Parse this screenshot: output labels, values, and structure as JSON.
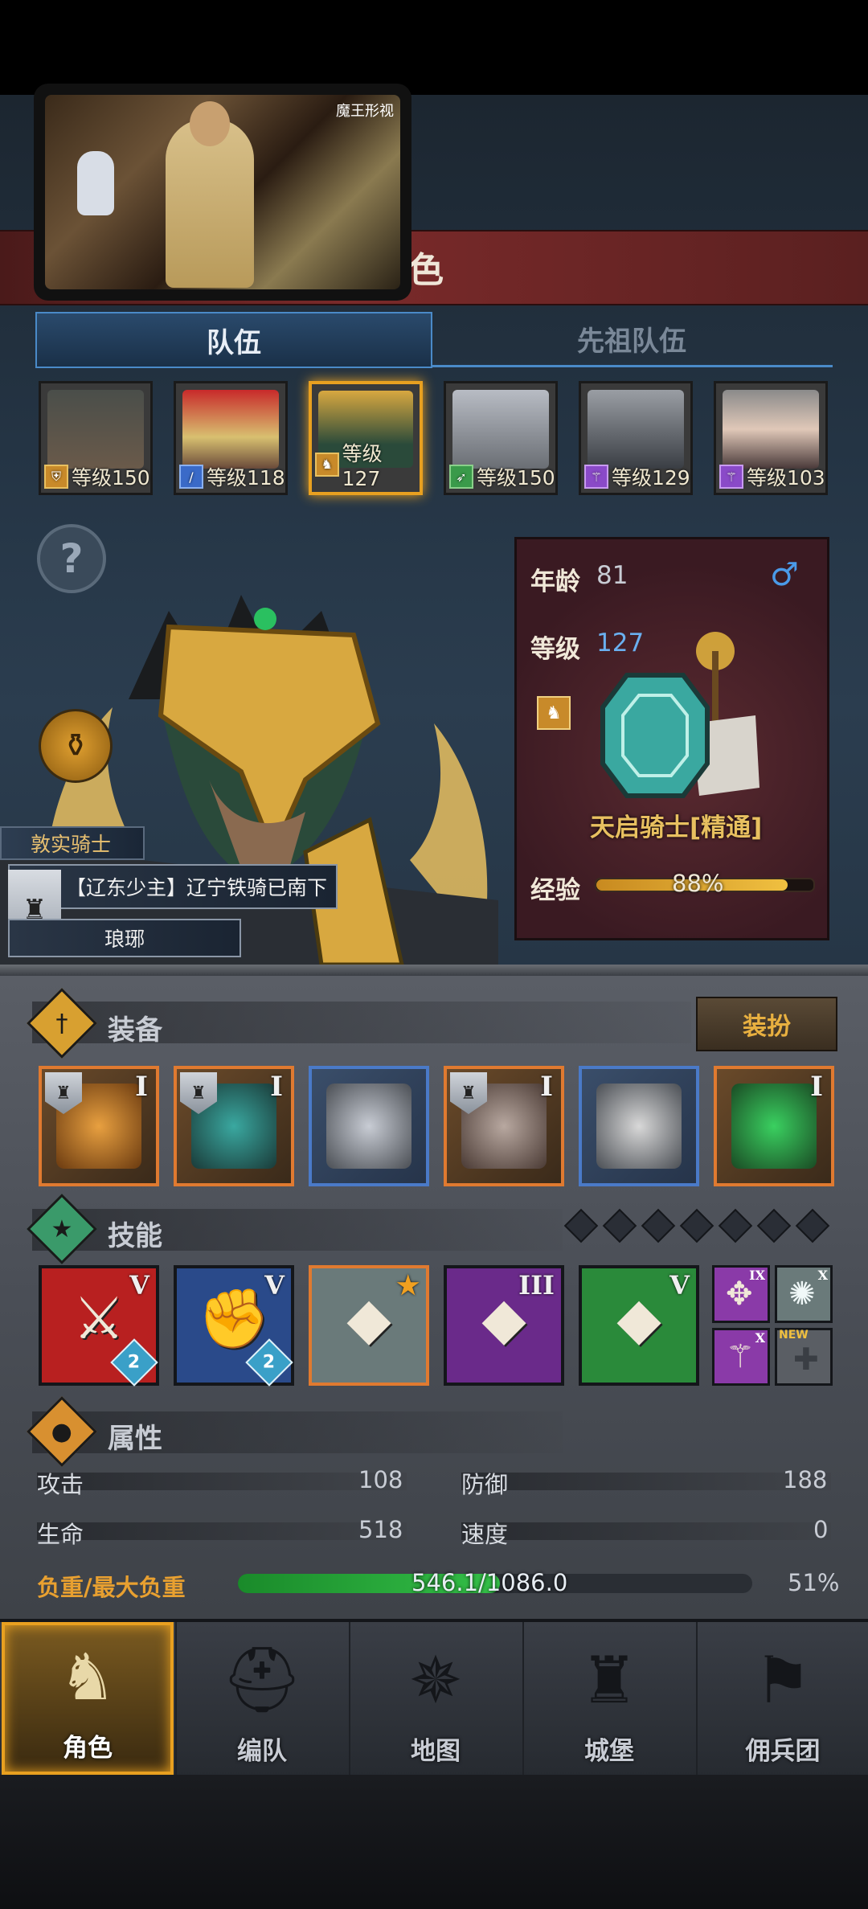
{
  "header": {
    "title": "角色"
  },
  "video": {
    "logo": "魔王形视"
  },
  "tabs": [
    {
      "label": "队伍",
      "active": true
    },
    {
      "label": "先祖队伍",
      "active": false
    }
  ],
  "team": [
    {
      "level": "等级150",
      "class_icon": "shield-class-icon",
      "color": "#d89030"
    },
    {
      "level": "等级118",
      "class_icon": "sword-class-icon",
      "color": "#3a6ac8"
    },
    {
      "level": "等级127",
      "class_icon": "horse-class-icon",
      "color": "#d89030",
      "selected": true
    },
    {
      "level": "等级150",
      "class_icon": "bow-class-icon",
      "color": "#3a9a4a"
    },
    {
      "level": "等级129",
      "class_icon": "staff-class-icon",
      "color": "#8a4ac8"
    },
    {
      "level": "等级103",
      "class_icon": "staff-class-icon",
      "color": "#8a4ac8"
    }
  ],
  "hero": {
    "title_plate": "敦实骑士",
    "name": "【辽东少主】辽宁铁骑已南下",
    "origin": "琅琊"
  },
  "stats_panel": {
    "age_label": "年龄",
    "age": "81",
    "level_label": "等级",
    "level": "127",
    "gender_symbol": "♂",
    "class_name": "天启骑士[精通]",
    "exp_label": "经验",
    "exp_value": "88%",
    "exp_fraction": 0.88
  },
  "equipment": {
    "title": "装备",
    "outfit_button": "装扮",
    "slots": [
      {
        "tier": "I",
        "style": "orange",
        "badge": true
      },
      {
        "tier": "I",
        "style": "orange",
        "badge": true
      },
      {
        "tier": "",
        "style": "blue",
        "badge": false
      },
      {
        "tier": "I",
        "style": "orange",
        "badge": true
      },
      {
        "tier": "",
        "style": "blue",
        "badge": false
      },
      {
        "tier": "I",
        "style": "orange",
        "badge": false
      }
    ]
  },
  "skills": {
    "title": "技能",
    "items": [
      {
        "tier": "V",
        "badge": "2",
        "bg": "#b82020"
      },
      {
        "tier": "V",
        "badge": "2",
        "bg": "#2a4a8a"
      },
      {
        "tier": "★",
        "badge": "",
        "bg": "#6a7a7a"
      },
      {
        "tier": "III",
        "badge": "",
        "bg": "#6a2a8a"
      },
      {
        "tier": "V",
        "badge": "",
        "bg": "#2a8a3a"
      }
    ],
    "mini": [
      {
        "tier": "IX",
        "bg": "#8a3aa8"
      },
      {
        "tier": "X",
        "bg": "#6a7a7a"
      },
      {
        "tier": "X",
        "bg": "#8a3aa8"
      },
      {
        "tier": "NEW",
        "bg": "#5a5e64"
      }
    ]
  },
  "attributes": {
    "title": "属性",
    "attack_label": "攻击",
    "attack": "108",
    "defense_label": "防御",
    "defense": "188",
    "hp_label": "生命",
    "hp": "518",
    "speed_label": "速度",
    "speed": "0",
    "load_label": "负重/最大负重",
    "load_value": "546.1/1086.0",
    "load_percent": "51%",
    "load_fraction": 0.51
  },
  "nav": [
    {
      "label": "角色",
      "active": true
    },
    {
      "label": "编队",
      "active": false
    },
    {
      "label": "地图",
      "active": false
    },
    {
      "label": "城堡",
      "active": false
    },
    {
      "label": "佣兵团",
      "active": false
    }
  ],
  "colors": {
    "accent": "#e8a020",
    "tab_blue": "#4a8ac8",
    "exp": "#f0c040",
    "load": "#34c048"
  }
}
